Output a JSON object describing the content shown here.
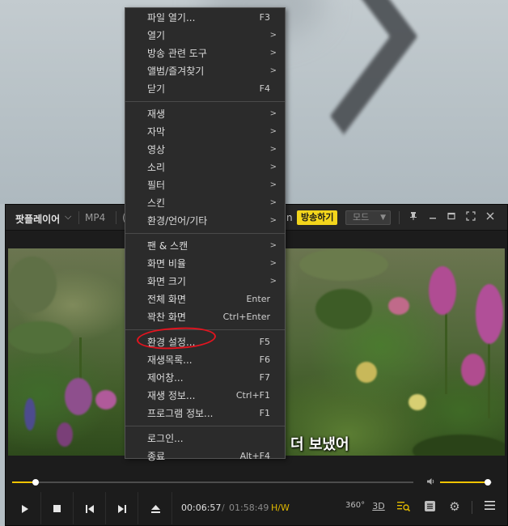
{
  "title_bar": {
    "brand": "팟플레이어",
    "brand_chevron": "⌵",
    "format": "MP4",
    "hidden_fragment_left": "(",
    "hidden_fragment_right": "n",
    "broadcast_button": "방송하기",
    "mode_select": "모드",
    "icons": [
      "pin-icon",
      "minimize-icon",
      "maximize-icon",
      "fullscreen-icon",
      "close-icon"
    ]
  },
  "video": {
    "subtitle": "더 보냈어"
  },
  "seek": {
    "progress": 0.0591,
    "volume": 0.92
  },
  "controls": {
    "current_time": "00:06:57",
    "separator": "/",
    "total_time": "01:58:49",
    "decoder": "H/W",
    "label_360": "360°",
    "label_3d": "3D"
  },
  "menu": {
    "groups": [
      [
        {
          "label": "파일 열기...",
          "shortcut": "F3",
          "submenu": false
        },
        {
          "label": "열기",
          "shortcut": "",
          "submenu": true
        },
        {
          "label": "방송 관련 도구",
          "shortcut": "",
          "submenu": true
        },
        {
          "label": "앨범/즐겨찾기",
          "shortcut": "",
          "submenu": true
        },
        {
          "label": "닫기",
          "shortcut": "F4",
          "submenu": false
        }
      ],
      [
        {
          "label": "재생",
          "shortcut": "",
          "submenu": true
        },
        {
          "label": "자막",
          "shortcut": "",
          "submenu": true
        },
        {
          "label": "영상",
          "shortcut": "",
          "submenu": true
        },
        {
          "label": "소리",
          "shortcut": "",
          "submenu": true
        },
        {
          "label": "필터",
          "shortcut": "",
          "submenu": true
        },
        {
          "label": "스킨",
          "shortcut": "",
          "submenu": true
        },
        {
          "label": "환경/언어/기타",
          "shortcut": "",
          "submenu": true
        }
      ],
      [
        {
          "label": "팬 & 스캔",
          "shortcut": "",
          "submenu": true
        },
        {
          "label": "화면 비율",
          "shortcut": "",
          "submenu": true
        },
        {
          "label": "화면 크기",
          "shortcut": "",
          "submenu": true
        },
        {
          "label": "전체 화면",
          "shortcut": "Enter",
          "submenu": false
        },
        {
          "label": "꽉찬 화면",
          "shortcut": "Ctrl+Enter",
          "submenu": false
        }
      ],
      [
        {
          "label": "환경 설정...",
          "shortcut": "F5",
          "submenu": false
        },
        {
          "label": "재생목록...",
          "shortcut": "F6",
          "submenu": false
        },
        {
          "label": "제어창...",
          "shortcut": "F7",
          "submenu": false
        },
        {
          "label": "재생 정보...",
          "shortcut": "Ctrl+F1",
          "submenu": false
        },
        {
          "label": "프로그램 정보...",
          "shortcut": "F1",
          "submenu": false
        }
      ],
      [
        {
          "label": "로그인...",
          "shortcut": "",
          "submenu": false
        },
        {
          "label": "종료",
          "shortcut": "Alt+F4",
          "submenu": false
        }
      ]
    ],
    "submenu_arrow": ">"
  },
  "colors": {
    "accent": "#f0c400",
    "broadcast": "#f3d51c",
    "annotation": "#e2141f"
  }
}
